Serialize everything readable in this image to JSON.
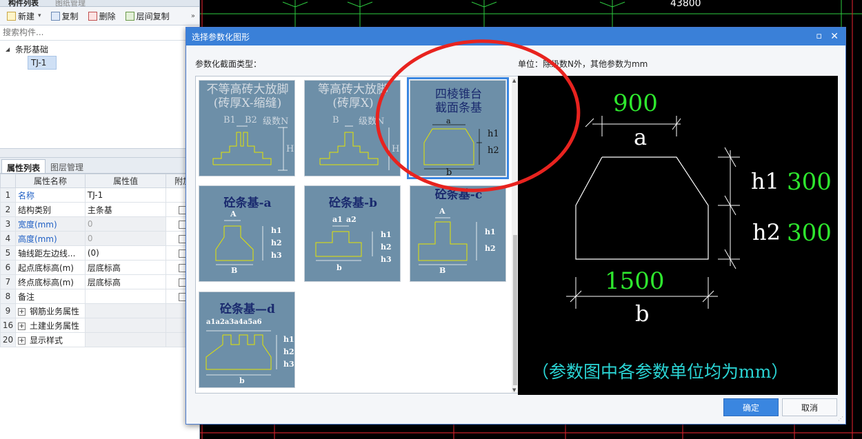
{
  "left_panel": {
    "tabs": [
      "构件列表",
      "图纸管理"
    ],
    "toolbar": {
      "new": "新建",
      "copy": "复制",
      "delete": "删除",
      "layer_copy": "层间复制"
    },
    "search_placeholder": "搜索构件...",
    "tree": {
      "parent": "条形基础",
      "child": "TJ-1"
    },
    "prop_tabs": [
      "属性列表",
      "图层管理"
    ],
    "prop_headers": [
      "属性名称",
      "属性值",
      "附加"
    ],
    "props": [
      {
        "no": "1",
        "name": "名称",
        "value": "TJ-1"
      },
      {
        "no": "2",
        "name": "结构类别",
        "value": "主条基"
      },
      {
        "no": "3",
        "name": "宽度(mm)",
        "value": "0"
      },
      {
        "no": "4",
        "name": "高度(mm)",
        "value": "0"
      },
      {
        "no": "5",
        "name": "轴线距左边线...",
        "value": "(0)"
      },
      {
        "no": "6",
        "name": "起点底标高(m)",
        "value": "层底标高"
      },
      {
        "no": "7",
        "name": "终点底标高(m)",
        "value": "层底标高"
      },
      {
        "no": "8",
        "name": "备注",
        "value": ""
      },
      {
        "no": "9",
        "name": "钢筋业务属性",
        "value": ""
      },
      {
        "no": "16",
        "name": "土建业务属性",
        "value": ""
      },
      {
        "no": "20",
        "name": "显示样式",
        "value": ""
      }
    ]
  },
  "cad": {
    "dimension_label": "43800"
  },
  "dialog": {
    "title": "选择参数化图形",
    "section_type": "参数化截面类型：",
    "unit_text": "单位：除级数N外，其他参数为mm",
    "ok": "确定",
    "cancel": "取消",
    "thumbs": [
      {
        "title1": "不等高砖大放脚",
        "title2": "(砖厚X-缩缝)",
        "labels": [
          "B1",
          "B2",
          "级数N",
          "H"
        ]
      },
      {
        "title1": "等高砖大放脚",
        "title2": "(砖厚X)",
        "labels": [
          "B",
          "级数N",
          "H"
        ]
      },
      {
        "title1": "四棱锥台",
        "title2": "截面条基",
        "labels": [
          "a",
          "h1",
          "h2",
          "b"
        ]
      },
      {
        "title1": "砼条基-a",
        "labels": [
          "A",
          "h1",
          "h2",
          "h3",
          "B"
        ]
      },
      {
        "title1": "砼条基-b",
        "labels": [
          "a1",
          "a2",
          "h1",
          "h2",
          "h3",
          "b"
        ]
      },
      {
        "title1": "砼条基-c",
        "labels": [
          "A",
          "h1",
          "h2",
          "B"
        ]
      },
      {
        "title1": "砼条基—d",
        "labels": [
          "a1a2a3a4a5a6",
          "h1",
          "h2",
          "h3",
          "b"
        ]
      }
    ],
    "preview": {
      "a_value": "900",
      "a_label": "a",
      "h1_label": "h1",
      "h1_value": "300",
      "h2_label": "h2",
      "h2_value": "300",
      "b_value": "1500",
      "b_label": "b",
      "note": "（参数图中各参数单位均为mm）"
    }
  }
}
